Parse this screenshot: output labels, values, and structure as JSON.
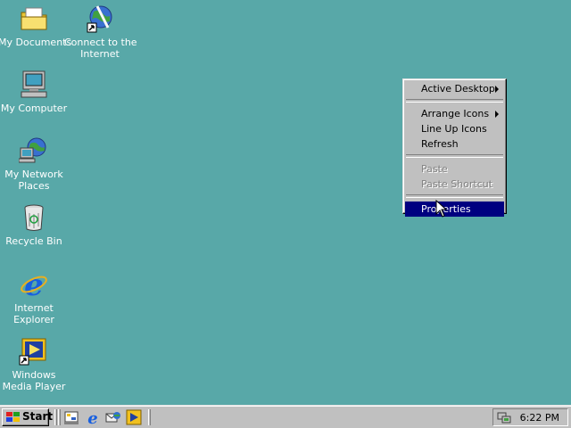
{
  "desktop": {
    "icons": [
      {
        "label_line1": "My Documents",
        "label_line2": "",
        "icon": "my-documents-icon"
      },
      {
        "label_line1": "Connect to the",
        "label_line2": "Internet",
        "icon": "connect-internet-icon"
      },
      {
        "label_line1": "My Computer",
        "label_line2": "",
        "icon": "my-computer-icon"
      },
      {
        "label_line1": "My Network",
        "label_line2": "Places",
        "icon": "network-places-icon"
      },
      {
        "label_line1": "Recycle Bin",
        "label_line2": "",
        "icon": "recycle-bin-icon"
      },
      {
        "label_line1": "Internet",
        "label_line2": "Explorer",
        "icon": "internet-explorer-icon"
      },
      {
        "label_line1": "Windows",
        "label_line2": "Media Player",
        "icon": "media-player-icon"
      }
    ],
    "background_color": "#58a8a8"
  },
  "context_menu": {
    "items": [
      {
        "label": "Active Desktop",
        "submenu": true,
        "enabled": true
      },
      {
        "label": "Arrange Icons",
        "submenu": true,
        "enabled": true
      },
      {
        "label": "Line Up Icons",
        "submenu": false,
        "enabled": true
      },
      {
        "label": "Refresh",
        "submenu": false,
        "enabled": true
      },
      {
        "label": "Paste",
        "submenu": false,
        "enabled": false
      },
      {
        "label": "Paste Shortcut",
        "submenu": false,
        "enabled": false
      },
      {
        "label": "Properties",
        "submenu": false,
        "enabled": true,
        "selected": true
      }
    ],
    "highlight_color": "#000080"
  },
  "taskbar": {
    "start_label": "Start",
    "quick_launch": [
      "show-desktop-icon",
      "internet-explorer-icon",
      "outlook-express-icon",
      "media-player-icon"
    ],
    "clock": "6:22 PM"
  }
}
